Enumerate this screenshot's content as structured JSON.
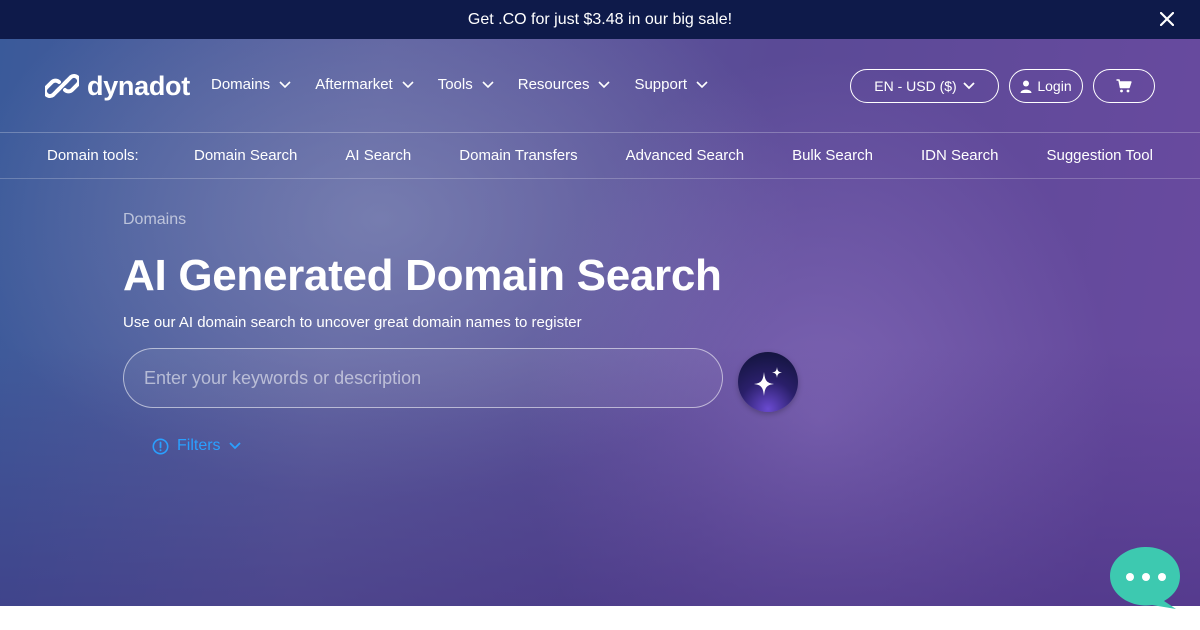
{
  "promo": {
    "text": "Get .CO for just $3.48 in our big sale!"
  },
  "logo": {
    "text": "dynadot"
  },
  "nav": {
    "items": [
      {
        "label": "Domains"
      },
      {
        "label": "Aftermarket"
      },
      {
        "label": "Tools"
      },
      {
        "label": "Resources"
      },
      {
        "label": "Support"
      }
    ],
    "language": "EN - USD ($)",
    "login": "Login"
  },
  "domain_tools": {
    "label": "Domain tools:",
    "links": [
      {
        "label": "Domain Search"
      },
      {
        "label": "AI Search"
      },
      {
        "label": "Domain Transfers"
      },
      {
        "label": "Advanced Search"
      },
      {
        "label": "Bulk Search"
      },
      {
        "label": "IDN Search"
      },
      {
        "label": "Suggestion Tool"
      }
    ]
  },
  "hero": {
    "breadcrumb": "Domains",
    "title": "AI Generated Domain Search",
    "subtitle": "Use our AI domain search to uncover great domain names to register",
    "search_placeholder": "Enter your keywords or description",
    "filters_label": "Filters"
  },
  "icons": {
    "close": "close-icon",
    "logo": "chain-link-icon",
    "chevron": "chevron-down-icon",
    "user": "user-icon",
    "cart": "cart-icon",
    "sparkle": "sparkle-icon",
    "info": "info-circle-icon",
    "chat": "chat-icon"
  },
  "colors": {
    "promo_bg": "#0e1a4a",
    "accent_link": "#2aa0ff",
    "chat_teal": "#3dc9b0"
  }
}
